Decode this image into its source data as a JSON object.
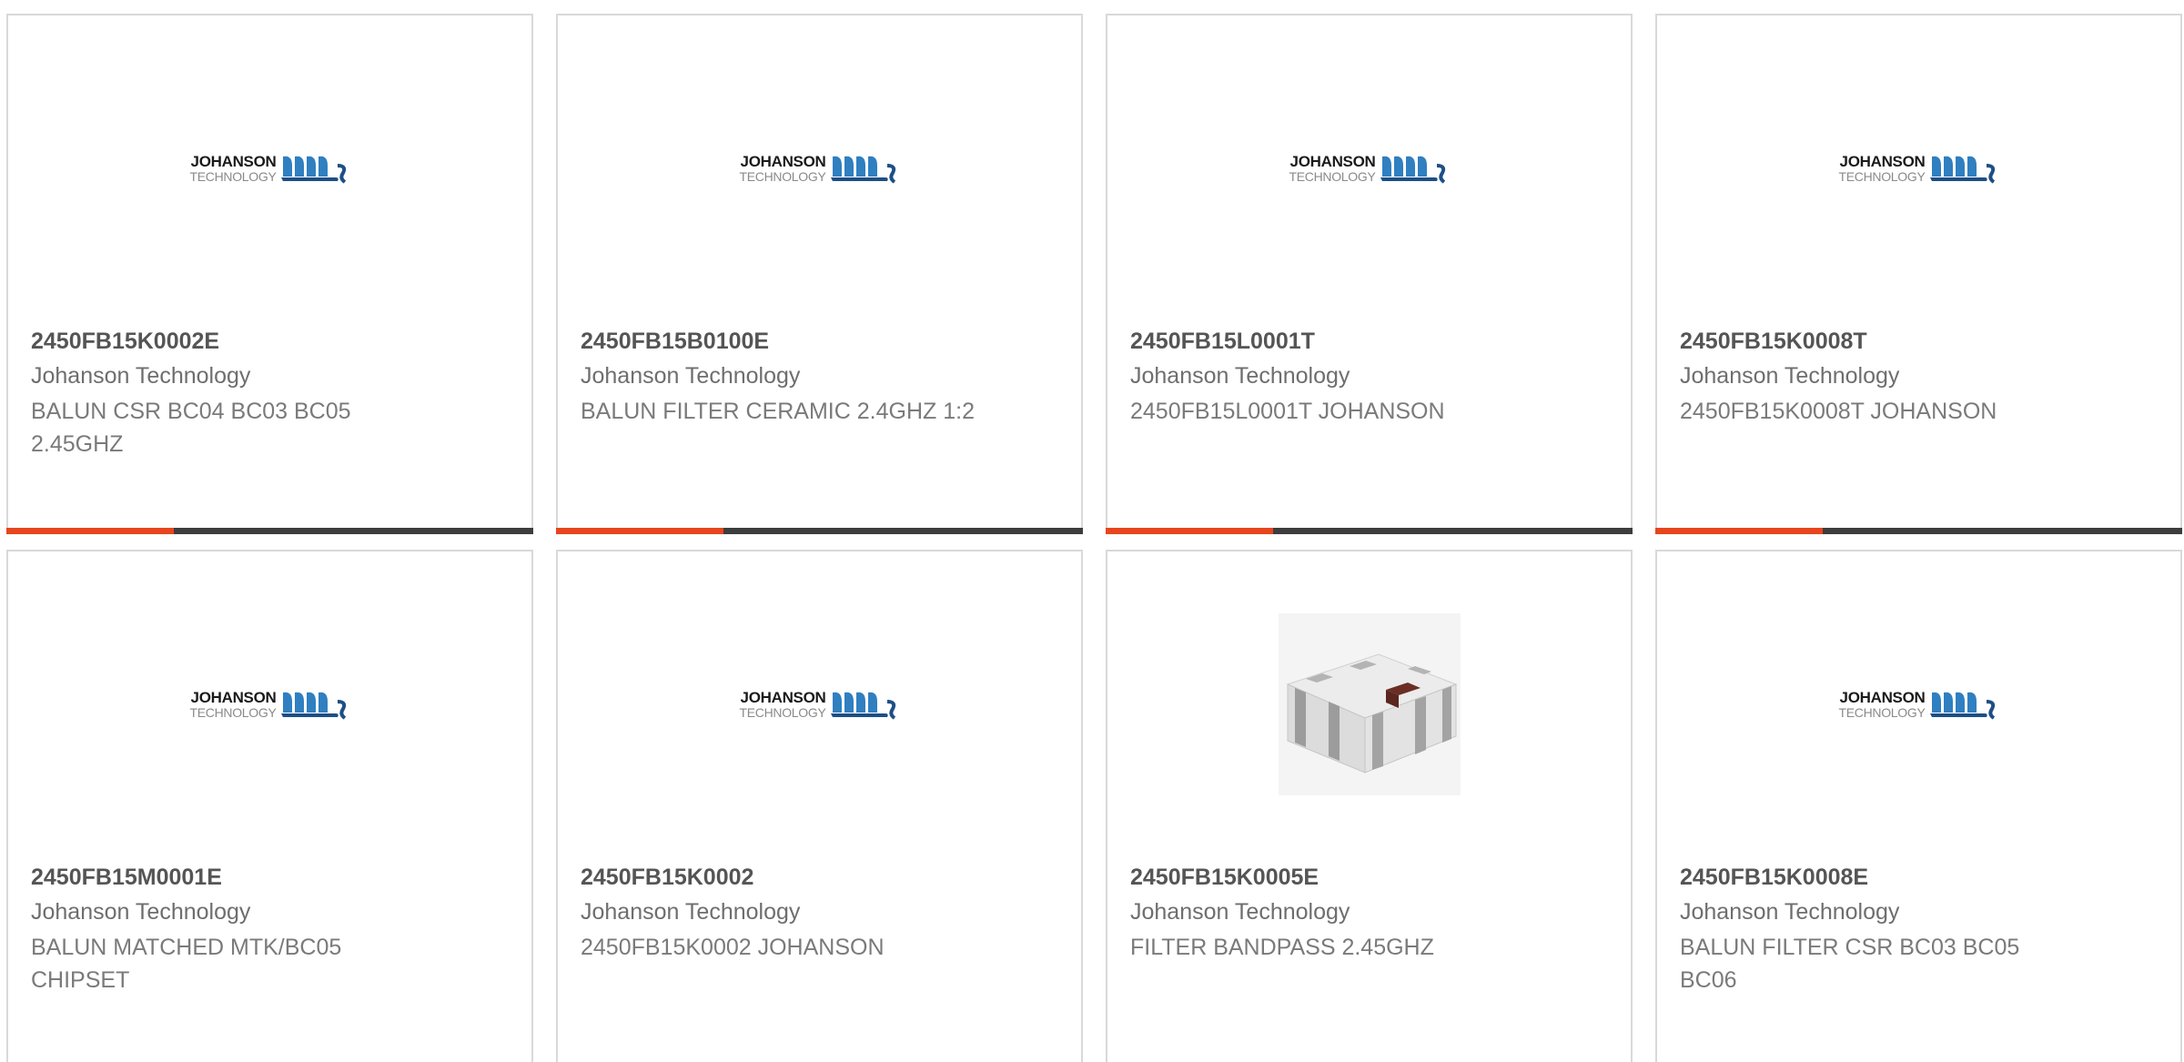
{
  "colors": {
    "accent_bar": "#e8451e",
    "dark_bar": "#3d3d3d",
    "card_border": "#d9d9d9"
  },
  "logo": {
    "top": "JOHANSON",
    "bottom": "TECHNOLOGY"
  },
  "products": [
    {
      "part_number": "2450FB15K0002E",
      "manufacturer": "Johanson Technology",
      "description": "BALUN CSR BC04 BC03 BC05 2.45GHZ",
      "image": "johanson-logo"
    },
    {
      "part_number": "2450FB15B0100E",
      "manufacturer": "Johanson Technology",
      "description": "BALUN FILTER CERAMIC 2.4GHZ 1:2",
      "image": "johanson-logo"
    },
    {
      "part_number": "2450FB15L0001T",
      "manufacturer": "Johanson Technology",
      "description": "2450FB15L0001T JOHANSON",
      "image": "johanson-logo"
    },
    {
      "part_number": "2450FB15K0008T",
      "manufacturer": "Johanson Technology",
      "description": "2450FB15K0008T JOHANSON",
      "image": "johanson-logo"
    },
    {
      "part_number": "2450FB15M0001E",
      "manufacturer": "Johanson Technology",
      "description": "BALUN MATCHED MTK/BC05 CHIPSET",
      "image": "johanson-logo"
    },
    {
      "part_number": "2450FB15K0002",
      "manufacturer": "Johanson Technology",
      "description": "2450FB15K0002 JOHANSON",
      "image": "johanson-logo"
    },
    {
      "part_number": "2450FB15K0005E",
      "manufacturer": "Johanson Technology",
      "description": "FILTER BANDPASS 2.45GHZ",
      "image": "ceramic-chip-photo"
    },
    {
      "part_number": "2450FB15K0008E",
      "manufacturer": "Johanson Technology",
      "description": "BALUN FILTER CSR BC03 BC05 BC06",
      "image": "johanson-logo"
    }
  ]
}
